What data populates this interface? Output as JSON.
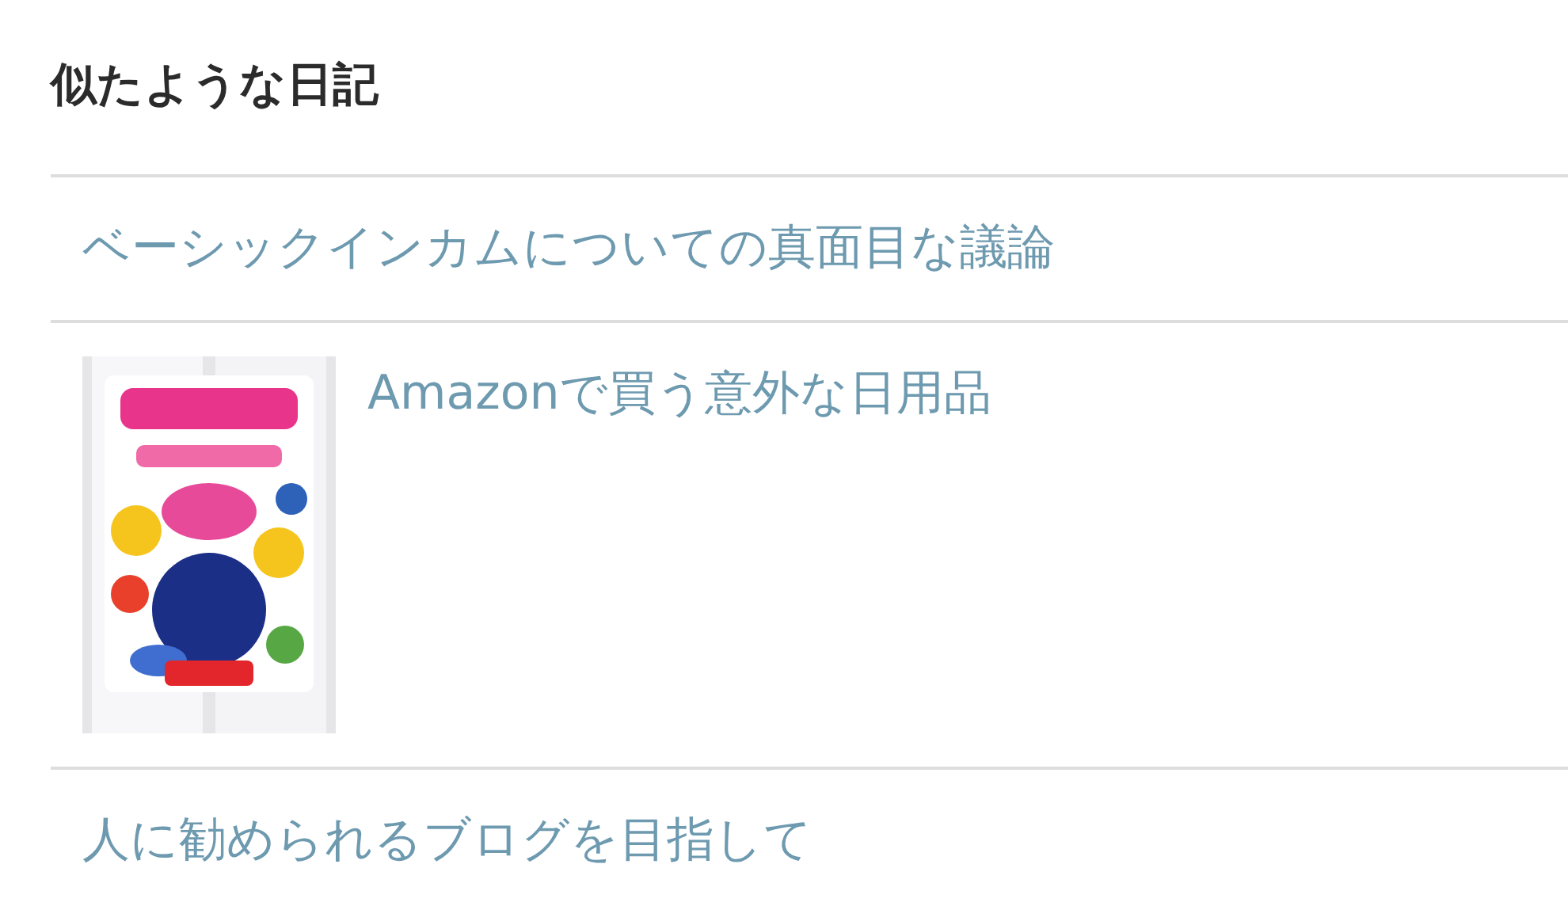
{
  "heading": "似たような日記",
  "entries": [
    {
      "title": "ベーシックインカムについての真面目な議論"
    },
    {
      "title": "Amazonで買う意外な日用品"
    },
    {
      "title": "人に勧められるブログを目指して"
    }
  ]
}
